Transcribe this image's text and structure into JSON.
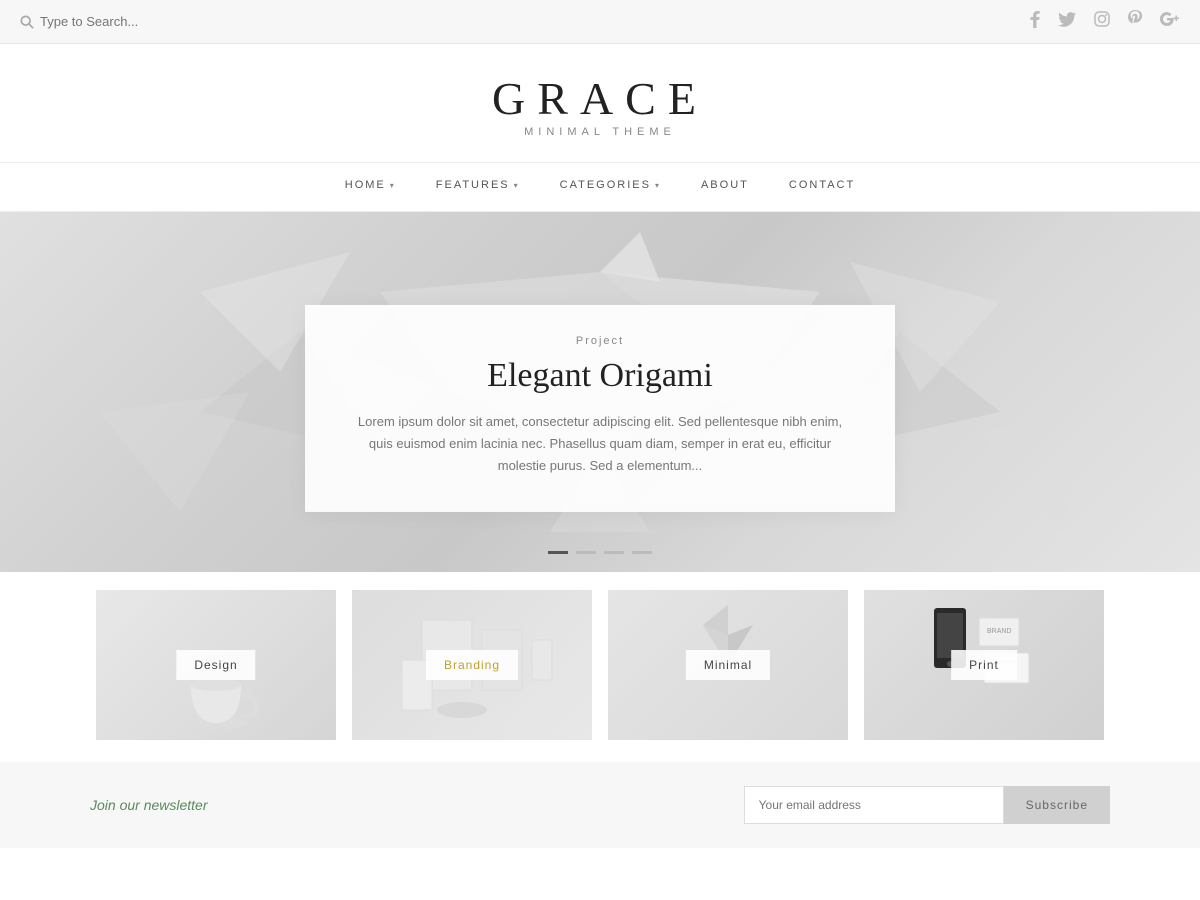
{
  "topbar": {
    "search_placeholder": "Type to Search..."
  },
  "social": {
    "items": [
      {
        "name": "facebook",
        "symbol": "f"
      },
      {
        "name": "twitter",
        "symbol": "t"
      },
      {
        "name": "instagram",
        "symbol": "i"
      },
      {
        "name": "pinterest",
        "symbol": "p"
      },
      {
        "name": "google-plus",
        "symbol": "g+"
      }
    ]
  },
  "header": {
    "title": "GRACE",
    "subtitle": "MINIMAL THEME"
  },
  "nav": {
    "items": [
      {
        "label": "HOME",
        "has_dropdown": true
      },
      {
        "label": "FEATURES",
        "has_dropdown": true
      },
      {
        "label": "CATEGORIES",
        "has_dropdown": true
      },
      {
        "label": "ABOUT",
        "has_dropdown": false
      },
      {
        "label": "CONTACT",
        "has_dropdown": false
      }
    ]
  },
  "hero": {
    "card": {
      "category": "Project",
      "title": "Elegant Origami",
      "text": "Lorem ipsum dolor sit amet, consectetur adipiscing elit. Sed pellentesque nibh enim, quis euismod enim lacinia nec. Phasellus quam diam, semper in erat eu, efficitur molestie purus. Sed a elementum..."
    },
    "dots": 4,
    "active_dot": 0
  },
  "categories": [
    {
      "label": "Design",
      "type": "design"
    },
    {
      "label": "Branding",
      "type": "branding"
    },
    {
      "label": "Minimal",
      "type": "minimal"
    },
    {
      "label": "Print",
      "type": "print"
    }
  ],
  "newsletter": {
    "title": "Join our newsletter",
    "input_placeholder": "Your email address",
    "button_label": "Subscribe"
  }
}
